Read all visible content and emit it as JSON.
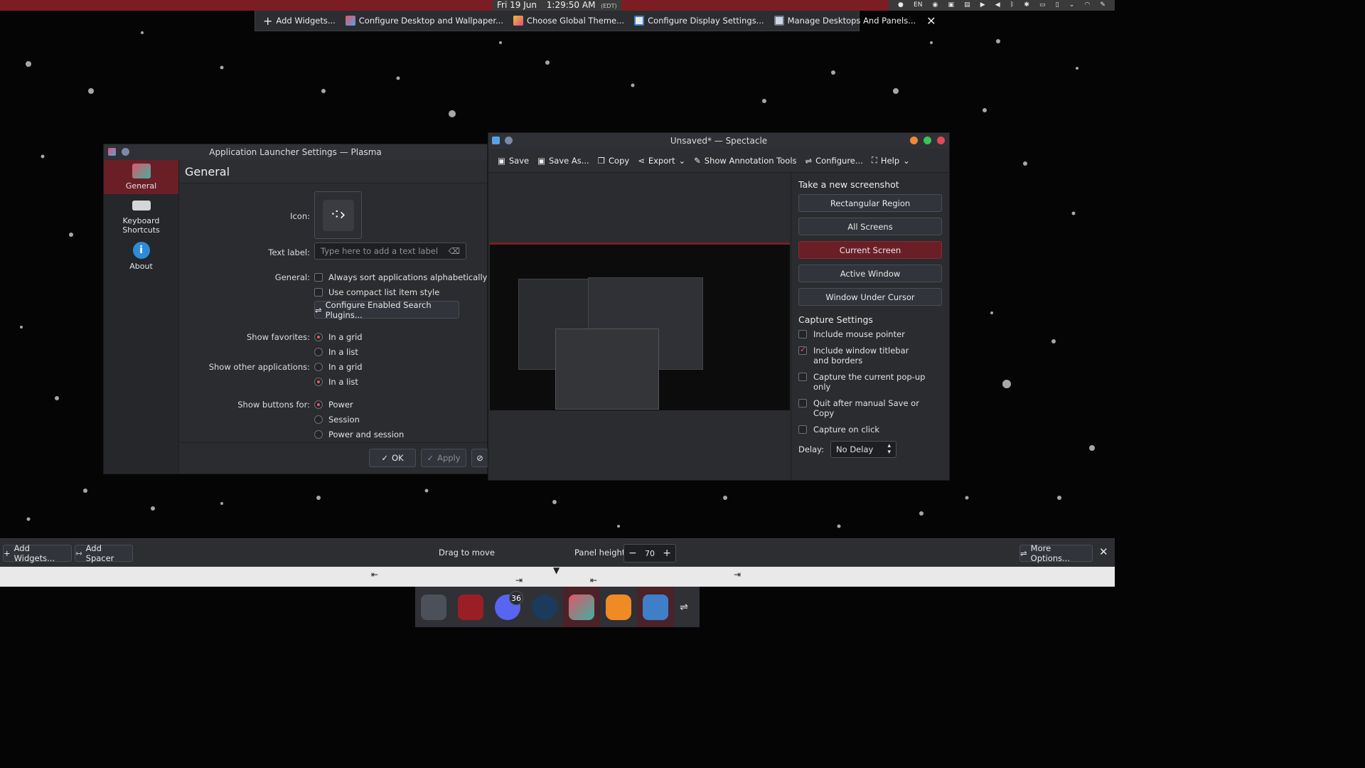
{
  "top_panel": {
    "date": "Fri 19 Jun",
    "time": "1:29:50 AM",
    "timezone": "(EDT)",
    "tray_items": [
      "discord-icon",
      "EN",
      "steam-icon",
      "clipboard-icon",
      "notes-icon",
      "media-icon",
      "volume-icon",
      "bluetooth-icon",
      "bluetooth-alt-icon",
      "display-icon",
      "battery-icon",
      "chevron-icon",
      "wifi-icon",
      "settings-icon",
      "pen-icon"
    ],
    "language": "EN"
  },
  "edit_toolbar": {
    "add_widgets": "Add Widgets...",
    "configure_desktop": "Configure Desktop and Wallpaper...",
    "global_theme": "Choose Global Theme...",
    "display_settings": "Configure Display Settings...",
    "manage_desktops": "Manage Desktops And Panels..."
  },
  "launcher": {
    "title": "Application Launcher Settings — Plasma",
    "sidebar": [
      {
        "label": "General"
      },
      {
        "label": "Keyboard\nShortcuts"
      },
      {
        "label": "About"
      }
    ],
    "heading": "General",
    "icon_label": "Icon:",
    "text_label": "Text label:",
    "text_placeholder": "Type here to add a text label",
    "general_label": "General:",
    "opt_sort": "Always sort applications alphabetically",
    "opt_compact": "Use compact list item style",
    "search_plugins": "Configure Enabled Search Plugins...",
    "favorites_label": "Show favorites:",
    "other_apps_label": "Show other applications:",
    "buttons_label": "Show buttons for:",
    "in_grid": "In a grid",
    "in_list": "In a list",
    "power": "Power",
    "session": "Session",
    "power_session": "Power and session",
    "ok": "OK",
    "apply": "Apply"
  },
  "spectacle": {
    "title": "Unsaved* — Spectacle",
    "toolbar": {
      "save": "Save",
      "save_as": "Save As...",
      "copy": "Copy",
      "export": "Export",
      "annotation": "Show Annotation Tools",
      "configure": "Configure...",
      "help": "Help"
    },
    "new_shot_heading": "Take a new screenshot",
    "modes": [
      "Rectangular Region",
      "All Screens",
      "Current Screen",
      "Active Window",
      "Window Under Cursor"
    ],
    "active_mode": "Current Screen",
    "capture_heading": "Capture Settings",
    "options": [
      {
        "label": "Include mouse pointer",
        "checked": false
      },
      {
        "label": "Include window titlebar and borders",
        "checked": true
      },
      {
        "label": "Capture the current pop-up only",
        "checked": false
      },
      {
        "label": "Quit after manual Save or Copy",
        "checked": false
      },
      {
        "label": "Capture on click",
        "checked": false
      }
    ],
    "delay_label": "Delay:",
    "delay_value": "No Delay"
  },
  "edit_bar": {
    "add_widgets": "Add Widgets...",
    "add_spacer": "Add Spacer",
    "drag_to_move": "Drag to move",
    "panel_height_label": "Panel height:",
    "panel_height_value": "70",
    "more_options": "More Options..."
  },
  "dock": {
    "discord_badge": "36"
  },
  "colors": {
    "accent": "#7c1d23",
    "active_bg": "#6a1f26",
    "window_bg": "#2a2c30"
  }
}
